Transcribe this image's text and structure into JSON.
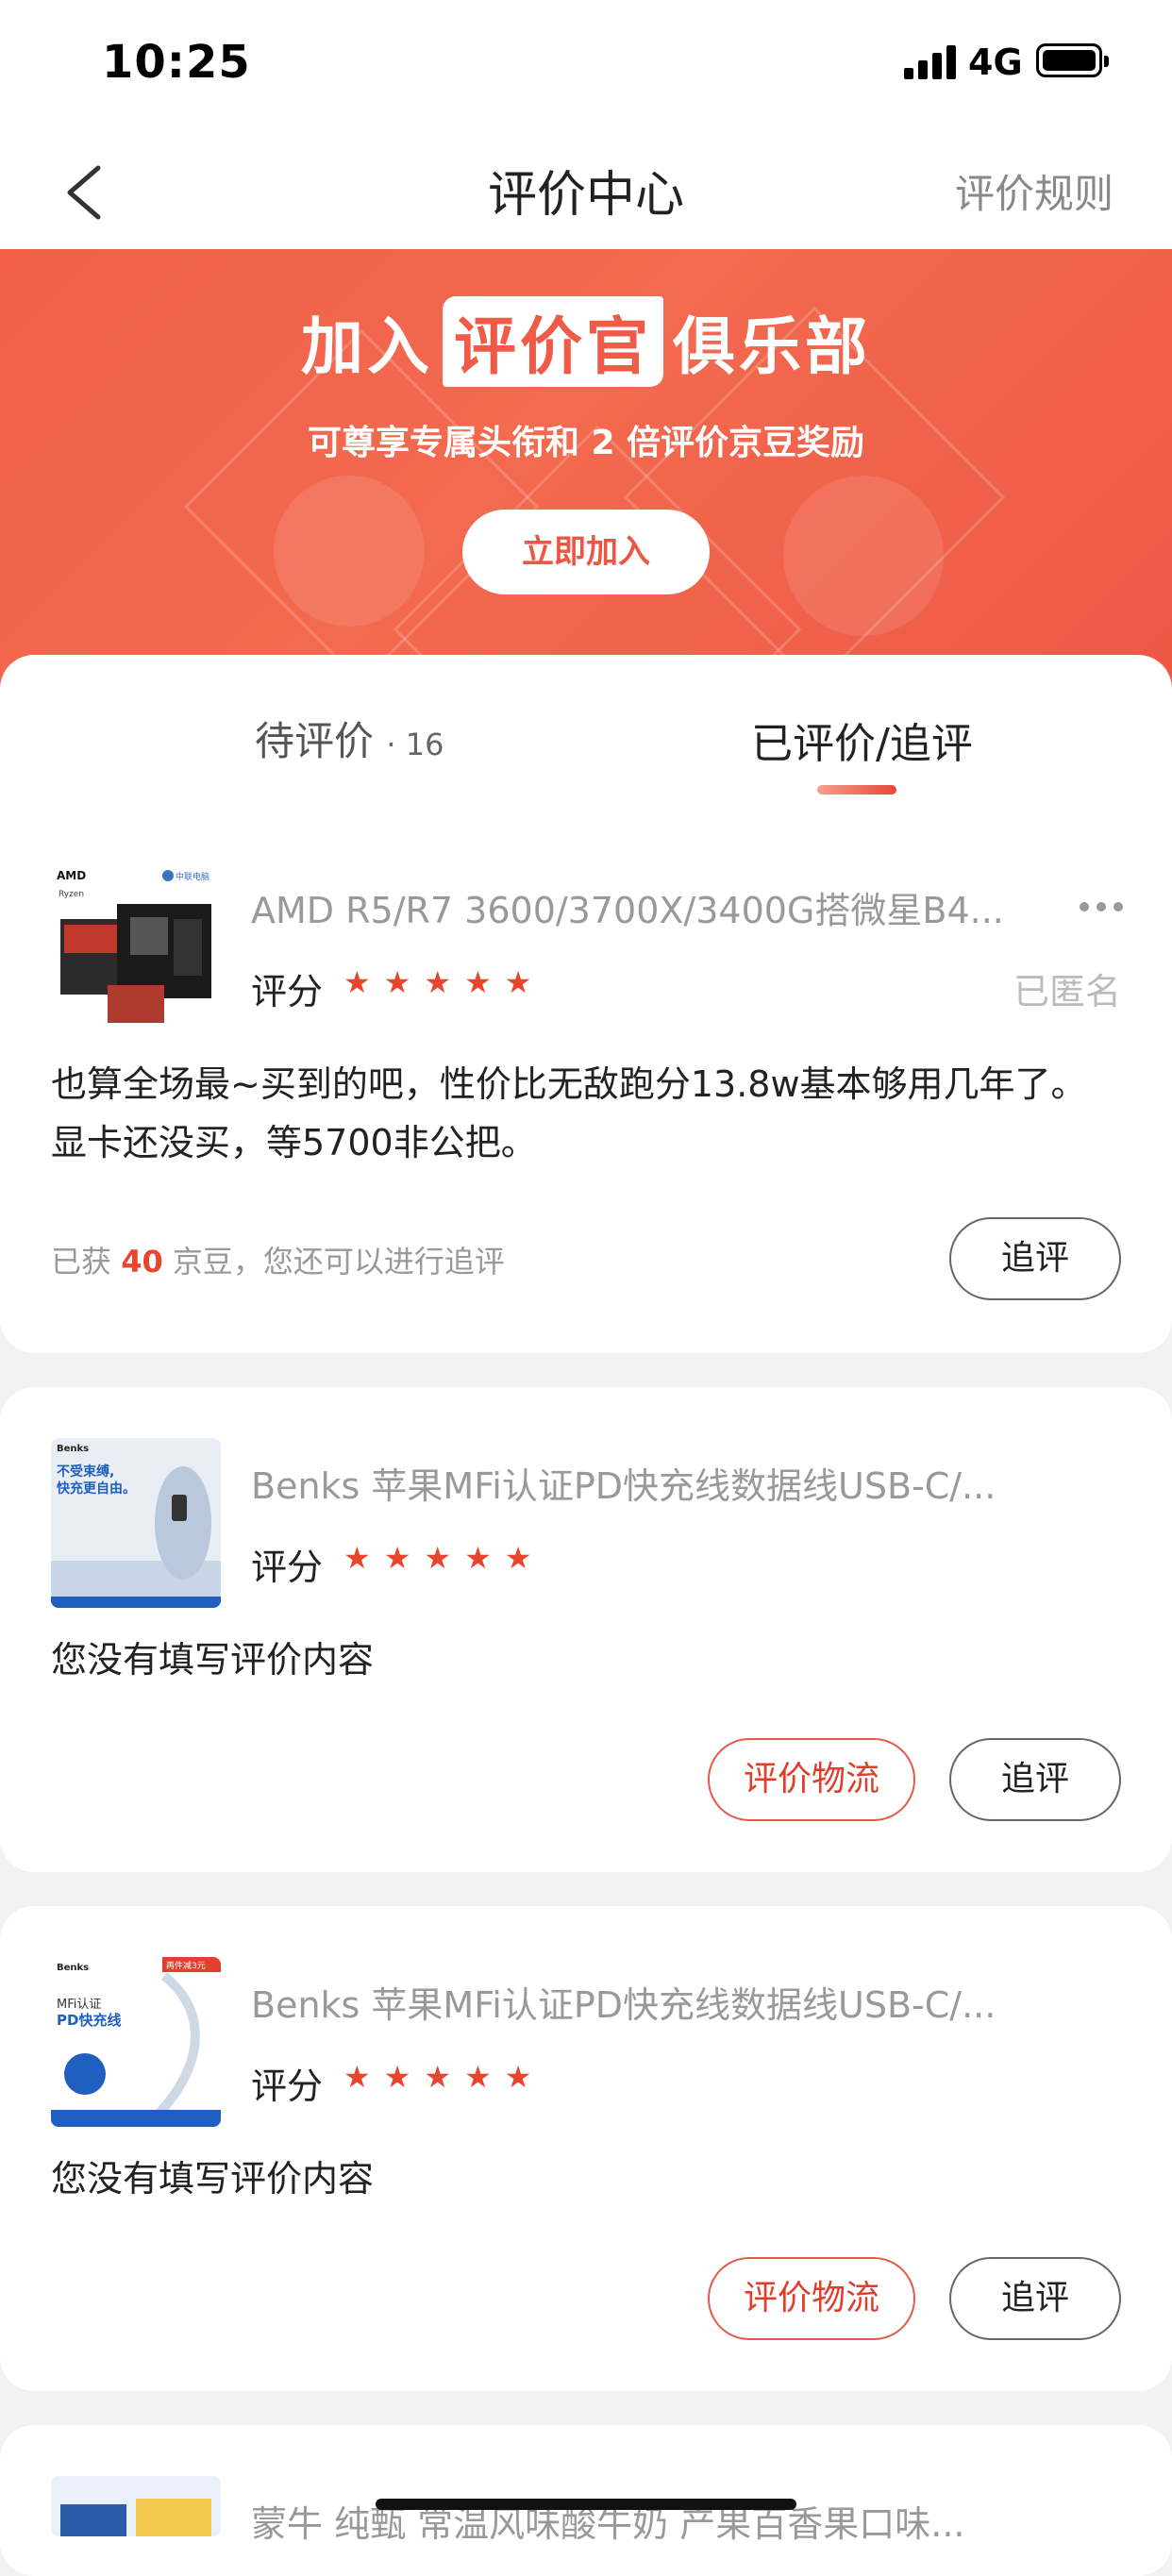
{
  "status": {
    "time": "10:25",
    "network": "4G"
  },
  "nav": {
    "title": "评价中心",
    "rules": "评价规则"
  },
  "banner": {
    "title_prefix": "加入",
    "title_highlight": "评价官",
    "title_suffix": "俱乐部",
    "subtitle": "可尊享专属头衔和 2 倍评价京豆奖励",
    "join_button": "立即加入"
  },
  "tabs": {
    "pending": {
      "label": "待评价",
      "separator": "·",
      "count": "16"
    },
    "done": {
      "label": "已评价/追评"
    }
  },
  "reviews": [
    {
      "product": "AMD R5/R7 3600/3700X/3400G搭微星B4...",
      "rating_label": "评分",
      "stars": "★★★★★",
      "anonymous": "已匿名",
      "text": "也算全场最~买到的吧，性价比无敌跑分13.8w基本够用几年了。显卡还没买，等5700非公把。",
      "beans_prefix": "已获",
      "beans_count": "40",
      "beans_suffix": "京豆，您还可以进行追评",
      "followup_button": "追评",
      "thumb_text": "AMD",
      "thumb_badge": "中联电脑",
      "thumb_brand": "Ryzen"
    },
    {
      "product": "Benks 苹果MFi认证PD快充线数据线USB-C/...",
      "rating_label": "评分",
      "stars": "★★★★★",
      "text": "您没有填写评价内容",
      "logistics_button": "评价物流",
      "followup_button": "追评",
      "thumb_brand": "Benks",
      "thumb_line1": "不受束缚,",
      "thumb_line2": "快充更自由。"
    },
    {
      "product": "Benks 苹果MFi认证PD快充线数据线USB-C/...",
      "rating_label": "评分",
      "stars": "★★★★★",
      "text": "您没有填写评价内容",
      "logistics_button": "评价物流",
      "followup_button": "追评",
      "thumb_brand": "Benks",
      "thumb_line1": "MFi认证",
      "thumb_line2": "PD快充线",
      "thumb_tag": "再件减3元"
    },
    {
      "product": "蒙牛 纯甄 常温风味酸牛奶 产果百香果口味..."
    }
  ],
  "colors": {
    "accent": "#e8452f",
    "banner": "#f0604a"
  }
}
